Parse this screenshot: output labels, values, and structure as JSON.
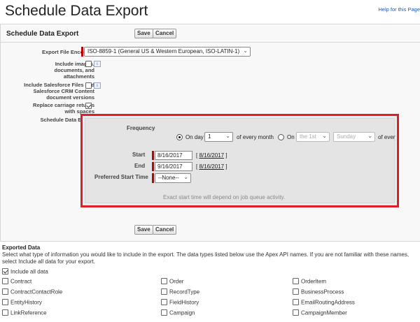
{
  "page": {
    "title": "Schedule Data Export",
    "help_link": "Help for this Page"
  },
  "panel": {
    "title": "Schedule Data Export",
    "save_label": "Save",
    "cancel_label": "Cancel"
  },
  "form": {
    "encoding_label": "Export File Encoding",
    "encoding_value": "ISO-8859-1 (General US & Western European, ISO-LATIN-1)",
    "include_images_label": "Include images, documents, and attachments",
    "include_images_checked": false,
    "include_files_label": "Include Salesforce Files and Salesforce CRM Content document versions",
    "include_files_checked": false,
    "replace_cr_label": "Replace carriage returns with spaces",
    "replace_cr_checked": true,
    "schedule_label": "Schedule Data Export",
    "info_icon": "i"
  },
  "schedule": {
    "frequency_label": "Frequency",
    "on_day_label": "On day",
    "day_value": "1",
    "of_every_month_1": "of every month",
    "on_label": "On",
    "nth_value": "the 1st",
    "weekday_value": "Sunday",
    "of_every_month_2": "of every month",
    "start_label": "Start",
    "start_value": "8/16/2017",
    "start_link": "8/16/2017",
    "end_label": "End",
    "end_value": "9/16/2017",
    "end_link": "8/16/2017",
    "pref_time_label": "Preferred Start Time",
    "pref_time_value": "--None--",
    "note": "Exact start time will depend on job queue activity."
  },
  "exported": {
    "title": "Exported Data",
    "description": "Select what type of information you would like to include in the export. The data types listed below use the Apex API names. If you are not familiar with these names, select Include all data for your export.",
    "include_all_label": "Include all data",
    "include_all_checked": true,
    "items": [
      [
        "Contract",
        "Order",
        "OrderItem"
      ],
      [
        "ContractContactRole",
        "RecordType",
        "BusinessProcess"
      ],
      [
        "EntityHistory",
        "FieldHistory",
        "EmailRoutingAddress"
      ],
      [
        "LinkReference",
        "Campaign",
        "CampaignMember"
      ]
    ]
  },
  "colors": {
    "highlight_border": "#e01e2a",
    "required_bar": "#c00000",
    "link": "#1a5bb4"
  }
}
